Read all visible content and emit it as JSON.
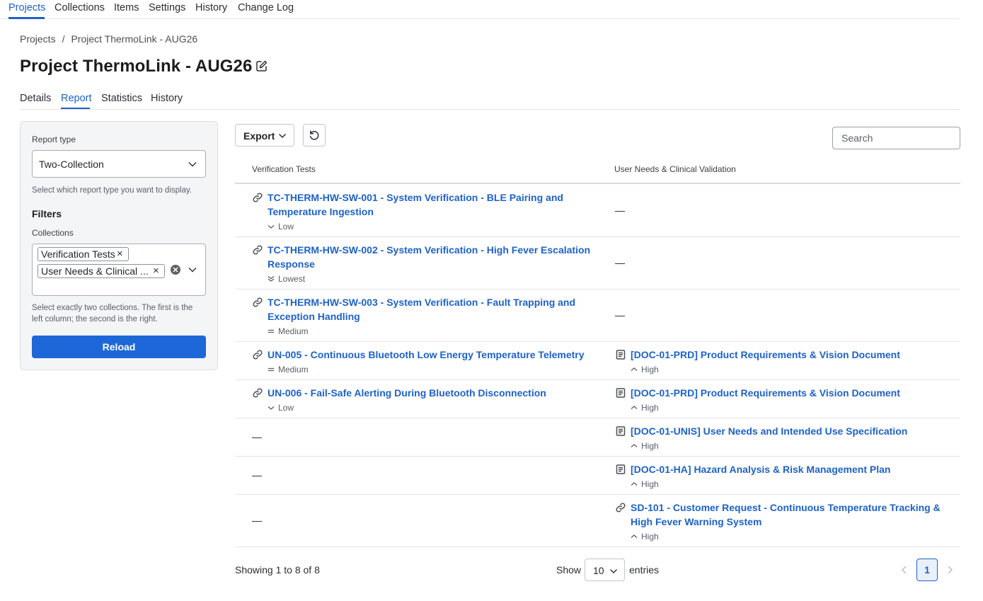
{
  "nav": {
    "items": [
      "Projects",
      "Collections",
      "Items",
      "Settings",
      "History",
      "Change Log"
    ]
  },
  "breadcrumb": {
    "root": "Projects",
    "separator": "/",
    "current": "Project ThermoLink - AUG26"
  },
  "page": {
    "title": "Project ThermoLink - AUG26"
  },
  "tabs": [
    "Details",
    "Report",
    "Statistics",
    "History"
  ],
  "sidebar": {
    "report_type_label": "Report type",
    "report_type_value": "Two-Collection",
    "report_type_help": "Select which report type you want to display.",
    "filters_heading": "Filters",
    "collections_label": "Collections",
    "chips": [
      "Verification Tests",
      "User Needs & Clinical ..."
    ],
    "collections_help_1": "Select exactly two collections. The first is the",
    "collections_help_2": "left column; the second is the right.",
    "reload_label": "Reload"
  },
  "toolbar": {
    "export_label": "Export",
    "search_placeholder": "Search"
  },
  "table": {
    "headers": [
      "Verification Tests",
      "User Needs & Clinical Validation"
    ],
    "empty": "—",
    "rows": [
      {
        "left": {
          "l1": "TC-THERM-HW-SW-001 - System Verification - BLE Pairing and",
          "l2": "Temperature Ingestion",
          "priority": "Low"
        },
        "right": null
      },
      {
        "left": {
          "l1": "TC-THERM-HW-SW-002 - System Verification - High Fever Escalation",
          "l2": "Response",
          "priority": "Lowest"
        },
        "right": null
      },
      {
        "left": {
          "l1": "TC-THERM-HW-SW-003 - System Verification - Fault Trapping and",
          "l2": "Exception Handling",
          "priority": "Medium"
        },
        "right": null
      },
      {
        "left": {
          "l1": "UN-005 - Continuous Bluetooth Low Energy Temperature Telemetry",
          "priority": "Medium"
        },
        "right": {
          "l1": "[DOC-01-PRD] Product Requirements & Vision Document",
          "priority": "High"
        }
      },
      {
        "left": {
          "l1": "UN-006 - Fail-Safe Alerting During Bluetooth Disconnection",
          "priority": "Low"
        },
        "right": {
          "l1": "[DOC-01-PRD] Product Requirements & Vision Document",
          "priority": "High"
        }
      },
      {
        "left": null,
        "right": {
          "l1": "[DOC-01-UNIS] User Needs and Intended Use Specification",
          "priority": "High"
        }
      },
      {
        "left": null,
        "right": {
          "l1": "[DOC-01-HA] Hazard Analysis & Risk Management Plan",
          "priority": "High"
        }
      },
      {
        "left": null,
        "right": {
          "l1": "SD-101 - Customer Request - Continuous Temperature Tracking &",
          "l2": "High Fever Warning System",
          "priority": "High"
        }
      }
    ]
  },
  "footer": {
    "showing": "Showing 1 to 8 of 8",
    "show_label": "Show",
    "page_size": "10",
    "entries_label": "entries",
    "current_page": "1"
  },
  "colors": {
    "accent": "#1d62c8",
    "button": "#1d67d8"
  }
}
